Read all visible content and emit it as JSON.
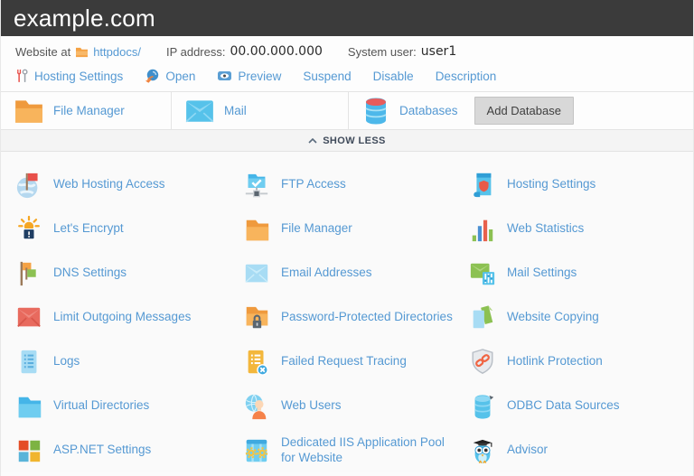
{
  "window": {
    "title": "example.com"
  },
  "info_bar": {
    "website_at_label": "Website at",
    "docroot_link": "httpdocs/",
    "ip_label": "IP address:",
    "ip_value": "00.00.000.000",
    "system_user_label": "System user:",
    "system_user_value": "user1"
  },
  "action_links": {
    "hosting_settings": "Hosting Settings",
    "open": "Open",
    "preview": "Preview",
    "suspend": "Suspend",
    "disable": "Disable",
    "description": "Description"
  },
  "shortcut_bar": {
    "file_manager": "File Manager",
    "mail": "Mail",
    "databases": "Databases",
    "add_database_button": "Add Database"
  },
  "show_less": {
    "label": "SHOW LESS"
  },
  "tools": [
    {
      "label": "Web Hosting Access",
      "icon": "globe-flag-icon"
    },
    {
      "label": "FTP Access",
      "icon": "ftp-folder-network-icon"
    },
    {
      "label": "Hosting Settings",
      "icon": "scroll-shield-icon"
    },
    {
      "label": "Let's Encrypt",
      "icon": "sun-padlock-icon"
    },
    {
      "label": "File Manager",
      "icon": "orange-folder-icon"
    },
    {
      "label": "Web Statistics",
      "icon": "bar-chart-icon"
    },
    {
      "label": "DNS Settings",
      "icon": "flags-icon"
    },
    {
      "label": "Email Addresses",
      "icon": "blue-envelope-icon"
    },
    {
      "label": "Mail Settings",
      "icon": "envelope-sliders-icon"
    },
    {
      "label": "Limit Outgoing Messages",
      "icon": "red-envelope-icon"
    },
    {
      "label": "Password-Protected Directories",
      "icon": "folder-lock-icon"
    },
    {
      "label": "Website Copying",
      "icon": "copy-pages-icon"
    },
    {
      "label": "Logs",
      "icon": "log-document-icon"
    },
    {
      "label": "Failed Request Tracing",
      "icon": "document-error-icon"
    },
    {
      "label": "Hotlink Protection",
      "icon": "shield-chain-icon"
    },
    {
      "label": "Virtual Directories",
      "icon": "blue-folder-icon"
    },
    {
      "label": "Web Users",
      "icon": "user-globe-icon"
    },
    {
      "label": "ODBC Data Sources",
      "icon": "blue-database-icon"
    },
    {
      "label": "ASP.NET Settings",
      "icon": "ms-squares-icon"
    },
    {
      "label": "Dedicated IIS Application Pool for Website",
      "icon": "app-pool-gears-icon"
    },
    {
      "label": "Advisor",
      "icon": "owl-icon"
    }
  ],
  "colors": {
    "header_bg": "#3b3b3b",
    "link_blue": "#5599d3",
    "accent_orange": "#f5a244",
    "button_bg": "#d8d8d8",
    "status_red": "#e8504a",
    "status_green": "#8cc152"
  }
}
